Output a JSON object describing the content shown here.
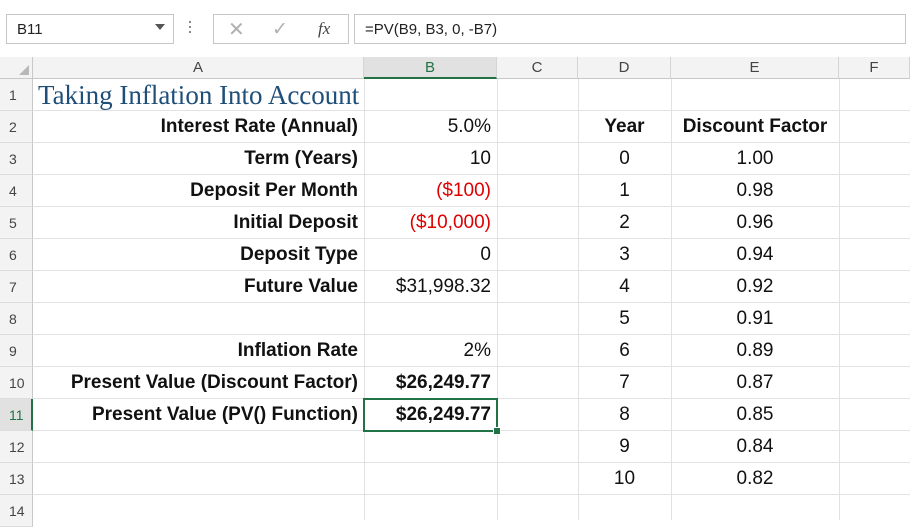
{
  "formula_bar": {
    "name_box": "B11",
    "fx_label": "fx",
    "formula": "=PV(B9, B3, 0, -B7)"
  },
  "columns": [
    "A",
    "B",
    "C",
    "D",
    "E",
    "F"
  ],
  "rows": [
    "1",
    "2",
    "3",
    "4",
    "5",
    "6",
    "7",
    "8",
    "9",
    "10",
    "11",
    "12",
    "13",
    "14"
  ],
  "sheet": {
    "title": "Taking Inflation Into Account",
    "labels": {
      "r2": "Interest Rate (Annual)",
      "r3": "Term (Years)",
      "r4": "Deposit Per Month",
      "r5": "Initial Deposit",
      "r6": "Deposit Type",
      "r7": "Future Value",
      "r9": "Inflation Rate",
      "r10": "Present Value (Discount Factor)",
      "r11": "Present Value (PV() Function)"
    },
    "values": {
      "r2": "5.0%",
      "r3": "10",
      "r4": "($100)",
      "r5": "($10,000)",
      "r6": "0",
      "r7": "$31,998.32",
      "r9": "2%",
      "r10": "$26,249.77",
      "r11": "$26,249.77"
    },
    "table_headers": {
      "year": "Year",
      "factor": "Discount Factor"
    },
    "table": [
      {
        "year": "0",
        "factor": "1.00"
      },
      {
        "year": "1",
        "factor": "0.98"
      },
      {
        "year": "2",
        "factor": "0.96"
      },
      {
        "year": "3",
        "factor": "0.94"
      },
      {
        "year": "4",
        "factor": "0.92"
      },
      {
        "year": "5",
        "factor": "0.91"
      },
      {
        "year": "6",
        "factor": "0.89"
      },
      {
        "year": "7",
        "factor": "0.87"
      },
      {
        "year": "8",
        "factor": "0.85"
      },
      {
        "year": "9",
        "factor": "0.84"
      },
      {
        "year": "10",
        "factor": "0.82"
      }
    ]
  },
  "colors": {
    "accent": "#217346",
    "negative": "#e00000",
    "title": "#1f4e79"
  }
}
